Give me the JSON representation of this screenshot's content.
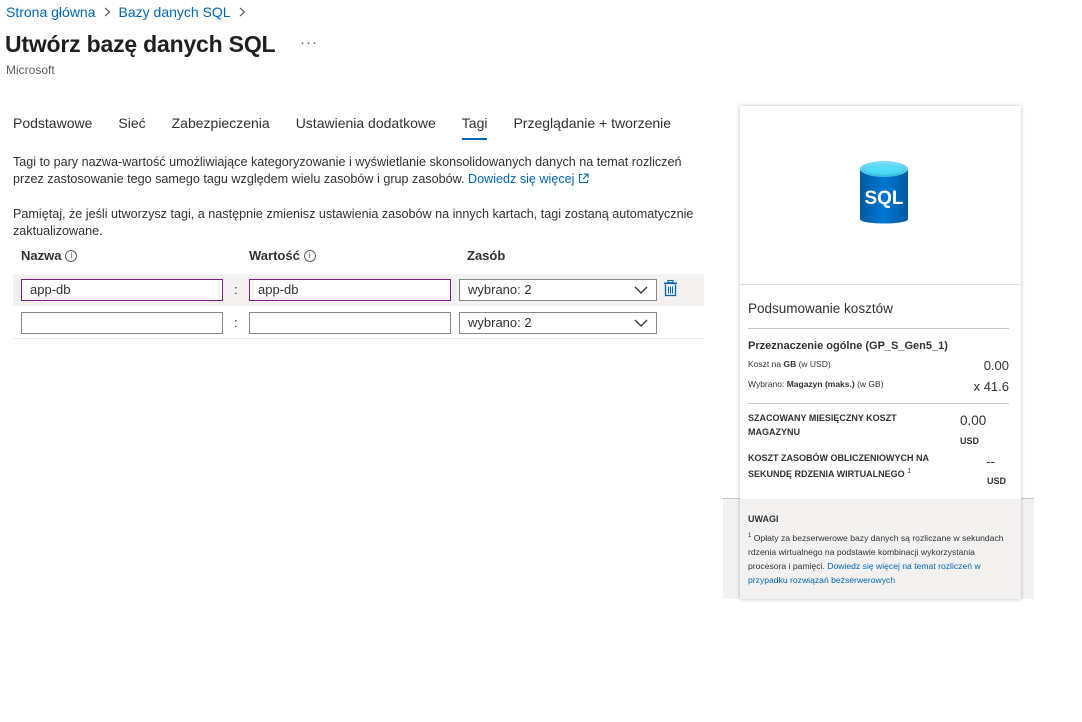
{
  "breadcrumb": {
    "home": "Strona główna",
    "parent": "Bazy danych SQL"
  },
  "page": {
    "title": "Utwórz bazę danych SQL",
    "more": "···",
    "publisher": "Microsoft"
  },
  "tabs": [
    {
      "label": "Podstawowe"
    },
    {
      "label": "Sieć"
    },
    {
      "label": "Zabezpieczenia"
    },
    {
      "label": "Ustawienia dodatkowe"
    },
    {
      "label": "Tagi",
      "active": true
    },
    {
      "label": "Przeglądanie + tworzenie"
    }
  ],
  "description": {
    "text1": "Tagi to pary nazwa-wartość umożliwiające kategoryzowanie i wyświetlanie skonsolidowanych danych na temat rozliczeń przez zastosowanie tego samego tagu względem wielu zasobów i grup zasobów.",
    "learn_more": "Dowiedz się więcej",
    "text2": "Pamiętaj, że jeśli utworzysz tagi, a następnie zmienisz ustawienia zasobów na innych kartach, tagi zostaną automatycznie zaktualizowane."
  },
  "table": {
    "headers": {
      "name": "Nazwa",
      "value": "Wartość",
      "resource": "Zasób"
    },
    "colon": ":",
    "rows": [
      {
        "name": "app-db",
        "value": "app-db",
        "resource": "wybrano: 2"
      },
      {
        "name": "",
        "value": "",
        "resource": "wybrano: 2"
      }
    ]
  },
  "summary": {
    "icon_text": "SQL",
    "title": "Podsumowanie kosztów",
    "sku": "Przeznaczenie ogólne (GP_S_Gen5_1)",
    "cost_per_gb_label": "Koszt na",
    "cost_per_gb_bold": "GB",
    "cost_per_gb_unit": "(w USD)",
    "cost_per_gb_value": "0.00",
    "selected_label": "Wybrano:",
    "selected_bold": "Magazyn (maks.)",
    "selected_unit": "(w GB)",
    "selected_value": "x 41.6",
    "monthly_label": "SZACOWANY MIESIĘCZNY KOSZT MAGAZYNU",
    "monthly_value": "0.00",
    "monthly_currency": "USD",
    "compute_label": "KOSZT ZASOBÓW OBLICZENIOWYCH NA SEKUNDĘ RDZENIA WIRTUALNEGO",
    "compute_sup": "1",
    "compute_value": "--",
    "compute_currency": "USD",
    "notes_title": "UWAGI",
    "notes_sup": "1",
    "notes_text": "Opłaty za bezserwerowe bazy danych są rozliczane w sekundach rdzenia wirtualnego na podstawie kombinacji wykorzystania procesora i pamięci.",
    "notes_link": "Dowiedz się więcej na temat rozliczeń w przypadku rozwiązań bezserwerowych"
  },
  "colors": {
    "accent": "#0067b8",
    "input_focus_border": "#7a1e8a",
    "sql_icon_blue": "#0078d4"
  },
  "icons": [
    "chevron-right-icon",
    "ellipsis-icon",
    "external-link-icon",
    "info-icon",
    "chevron-down-icon",
    "trash-icon",
    "sql-database-icon"
  ]
}
